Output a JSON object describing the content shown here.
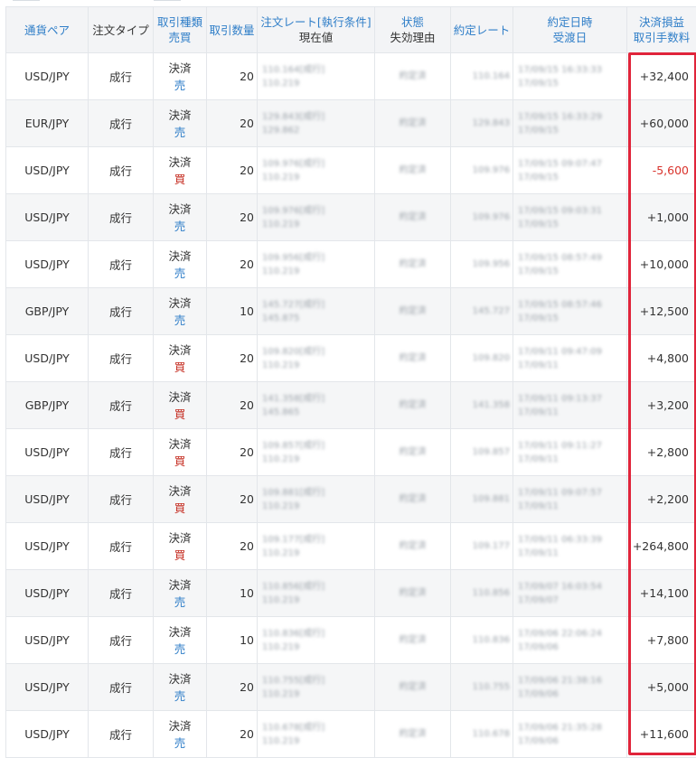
{
  "headers": {
    "pair": "通貨ペア",
    "order_type": "注文タイプ",
    "trade_kind_line1": "取引種類",
    "trade_kind_line2": "売買",
    "quantity": "取引数量",
    "order_rate_line1": "注文レート[執行条件]",
    "order_rate_line2": "現在値",
    "status_line1": "状態",
    "status_line2": "失効理由",
    "exec_rate": "約定レート",
    "exec_date_line1": "約定日時",
    "exec_date_line2": "受渡日",
    "pl_line1": "決済損益",
    "pl_line2": "取引手数料"
  },
  "colors": {
    "link_blue": "#2f7ec8",
    "buy_red": "#c4281c",
    "loss_red": "#d9332c",
    "highlight_red": "#e0243a"
  },
  "rows": [
    {
      "pair": "USD/JPY",
      "order_type": "成行",
      "kind": "決済",
      "side": "売",
      "side_type": "sell",
      "qty": "20",
      "order_rate": "110.164[成行]",
      "current": "110.219",
      "status": "約定済",
      "exec_rate": "110.164",
      "exec_date": "17/09/15 16:33:33",
      "settle": "17/09/15",
      "pl": "+32,400",
      "pl_negative": false
    },
    {
      "pair": "EUR/JPY",
      "order_type": "成行",
      "kind": "決済",
      "side": "売",
      "side_type": "sell",
      "qty": "20",
      "order_rate": "129.843[成行]",
      "current": "129.862",
      "status": "約定済",
      "exec_rate": "129.843",
      "exec_date": "17/09/15 16:33:29",
      "settle": "17/09/15",
      "pl": "+60,000",
      "pl_negative": false
    },
    {
      "pair": "USD/JPY",
      "order_type": "成行",
      "kind": "決済",
      "side": "買",
      "side_type": "buy",
      "qty": "20",
      "order_rate": "109.976[成行]",
      "current": "110.219",
      "status": "約定済",
      "exec_rate": "109.976",
      "exec_date": "17/09/15 09:07:47",
      "settle": "17/09/15",
      "pl": "-5,600",
      "pl_negative": true
    },
    {
      "pair": "USD/JPY",
      "order_type": "成行",
      "kind": "決済",
      "side": "売",
      "side_type": "sell",
      "qty": "20",
      "order_rate": "109.976[成行]",
      "current": "110.219",
      "status": "約定済",
      "exec_rate": "109.976",
      "exec_date": "17/09/15 09:03:31",
      "settle": "17/09/15",
      "pl": "+1,000",
      "pl_negative": false
    },
    {
      "pair": "USD/JPY",
      "order_type": "成行",
      "kind": "決済",
      "side": "売",
      "side_type": "sell",
      "qty": "20",
      "order_rate": "109.956[成行]",
      "current": "110.219",
      "status": "約定済",
      "exec_rate": "109.956",
      "exec_date": "17/09/15 08:57:49",
      "settle": "17/09/15",
      "pl": "+10,000",
      "pl_negative": false
    },
    {
      "pair": "GBP/JPY",
      "order_type": "成行",
      "kind": "決済",
      "side": "売",
      "side_type": "sell",
      "qty": "10",
      "order_rate": "145.727[成行]",
      "current": "145.875",
      "status": "約定済",
      "exec_rate": "145.727",
      "exec_date": "17/09/15 08:57:46",
      "settle": "17/09/15",
      "pl": "+12,500",
      "pl_negative": false
    },
    {
      "pair": "USD/JPY",
      "order_type": "成行",
      "kind": "決済",
      "side": "買",
      "side_type": "buy",
      "qty": "20",
      "order_rate": "109.820[成行]",
      "current": "110.219",
      "status": "約定済",
      "exec_rate": "109.820",
      "exec_date": "17/09/11 09:47:09",
      "settle": "17/09/11",
      "pl": "+4,800",
      "pl_negative": false
    },
    {
      "pair": "GBP/JPY",
      "order_type": "成行",
      "kind": "決済",
      "side": "買",
      "side_type": "buy",
      "qty": "20",
      "order_rate": "141.358[成行]",
      "current": "145.865",
      "status": "約定済",
      "exec_rate": "141.358",
      "exec_date": "17/09/11 09:13:37",
      "settle": "17/09/11",
      "pl": "+3,200",
      "pl_negative": false
    },
    {
      "pair": "USD/JPY",
      "order_type": "成行",
      "kind": "決済",
      "side": "買",
      "side_type": "buy",
      "qty": "20",
      "order_rate": "109.857[成行]",
      "current": "110.219",
      "status": "約定済",
      "exec_rate": "109.857",
      "exec_date": "17/09/11 09:11:27",
      "settle": "17/09/11",
      "pl": "+2,800",
      "pl_negative": false
    },
    {
      "pair": "USD/JPY",
      "order_type": "成行",
      "kind": "決済",
      "side": "買",
      "side_type": "buy",
      "qty": "20",
      "order_rate": "109.881[成行]",
      "current": "110.219",
      "status": "約定済",
      "exec_rate": "109.881",
      "exec_date": "17/09/11 09:07:57",
      "settle": "17/09/11",
      "pl": "+2,200",
      "pl_negative": false
    },
    {
      "pair": "USD/JPY",
      "order_type": "成行",
      "kind": "決済",
      "side": "買",
      "side_type": "buy",
      "qty": "20",
      "order_rate": "109.177[成行]",
      "current": "110.219",
      "status": "約定済",
      "exec_rate": "109.177",
      "exec_date": "17/09/11 06:33:39",
      "settle": "17/09/11",
      "pl": "+264,800",
      "pl_negative": false
    },
    {
      "pair": "USD/JPY",
      "order_type": "成行",
      "kind": "決済",
      "side": "売",
      "side_type": "sell",
      "qty": "10",
      "order_rate": "110.856[成行]",
      "current": "110.219",
      "status": "約定済",
      "exec_rate": "110.856",
      "exec_date": "17/09/07 16:03:54",
      "settle": "17/09/07",
      "pl": "+14,100",
      "pl_negative": false
    },
    {
      "pair": "USD/JPY",
      "order_type": "成行",
      "kind": "決済",
      "side": "売",
      "side_type": "sell",
      "qty": "10",
      "order_rate": "110.836[成行]",
      "current": "110.219",
      "status": "約定済",
      "exec_rate": "110.836",
      "exec_date": "17/09/06 22:06:24",
      "settle": "17/09/06",
      "pl": "+7,800",
      "pl_negative": false
    },
    {
      "pair": "USD/JPY",
      "order_type": "成行",
      "kind": "決済",
      "side": "売",
      "side_type": "sell",
      "qty": "20",
      "order_rate": "110.755[成行]",
      "current": "110.219",
      "status": "約定済",
      "exec_rate": "110.755",
      "exec_date": "17/09/06 21:38:16",
      "settle": "17/09/06",
      "pl": "+5,000",
      "pl_negative": false
    },
    {
      "pair": "USD/JPY",
      "order_type": "成行",
      "kind": "決済",
      "side": "売",
      "side_type": "sell",
      "qty": "20",
      "order_rate": "110.678[成行]",
      "current": "110.219",
      "status": "約定済",
      "exec_rate": "110.678",
      "exec_date": "17/09/06 21:35:28",
      "settle": "17/09/06",
      "pl": "+11,600",
      "pl_negative": false
    }
  ]
}
